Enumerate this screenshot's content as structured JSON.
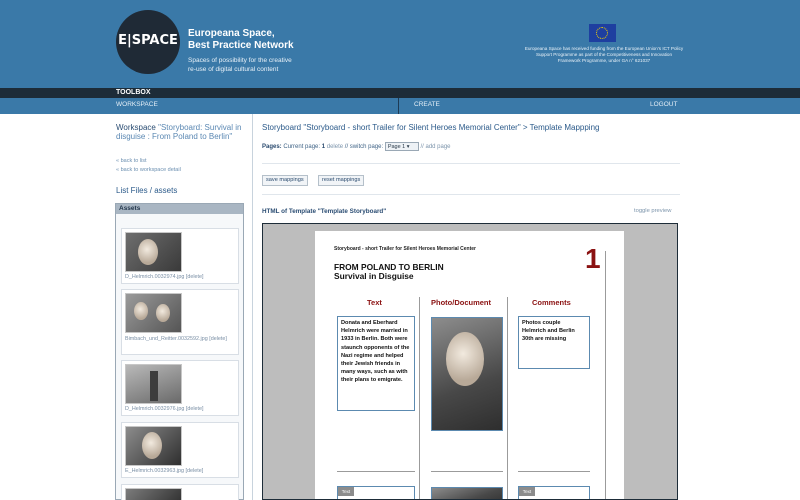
{
  "header": {
    "logo_text": "E|SPACE",
    "brand_title_1": "Europeana Space,",
    "brand_title_2": "Best Practice Network",
    "tagline_1": "Spaces of possibility for the creative",
    "tagline_2": "re-use of digital cultural content",
    "eu_note": "Europeana Space has received funding from the European Union's ICT Policy Support Programme as part of the Competitiveness and Innovation Framework Programme, under GA n° 621037"
  },
  "nav": {
    "toolbox": "TOOLBOX",
    "workspace": "WORKSPACE",
    "create": "CREATE",
    "logout": "LOGOUT"
  },
  "sidebar": {
    "workspace_prefix": "Workspace",
    "workspace_name": "\"Storyboard: Survival in disguise : From Poland to Berlin\"",
    "back_to_list": "« back to list",
    "back_to_detail": "« back to workspace detail",
    "list_files": "List Files / assets",
    "assets_heading": "Assets",
    "assets": [
      {
        "file": "D_Helmrich.0032974.jpg",
        "delete": "[delete]"
      },
      {
        "file": "Bimbach_und_Reitter.0032592.jpg",
        "delete": "[delete]"
      },
      {
        "file": "D_Helmrich.0032976.jpg",
        "delete": "[delete]"
      },
      {
        "file": "E_Helmrich.0032963.jpg",
        "delete": "[delete]"
      }
    ]
  },
  "main": {
    "breadcrumb": "Storyboard \"Storyboard - short Trailer for Silent Heroes Memorial Center\" > Template Mappping",
    "pages_label": "Pages:",
    "current_page_text": "Current page:",
    "current_page": "1",
    "delete_link": "delete",
    "switch_page_text": "// switch page:",
    "page_select": "Page 1",
    "add_page": "// add page",
    "save_mappings": "save mappings",
    "reset_mappings": "reset mappings",
    "template_title": "HTML of Template \"Template Storyboard\"",
    "toggle_preview": "toggle preview"
  },
  "storyboard": {
    "header_line": "Storyboard - short Trailer for Silent Heroes Memorial Center",
    "title_1": "FROM POLAND TO BERLIN",
    "title_2": "Survival in Disguise",
    "page_number": "1",
    "col_text": "Text",
    "col_photo": "Photo/Document",
    "col_comments": "Comments",
    "text_body": "Donata and Eberhard Helmrich were married in 1933 in Berlin. Both were staunch opponents of the Nazi regime and helped their Jewish friends in many ways, such as with their plans to emigrate.",
    "comment_body": "Photos couple Helmrich and Berlin 30th are missing",
    "tag_text": "Text",
    "tag_text_2": "Text"
  }
}
